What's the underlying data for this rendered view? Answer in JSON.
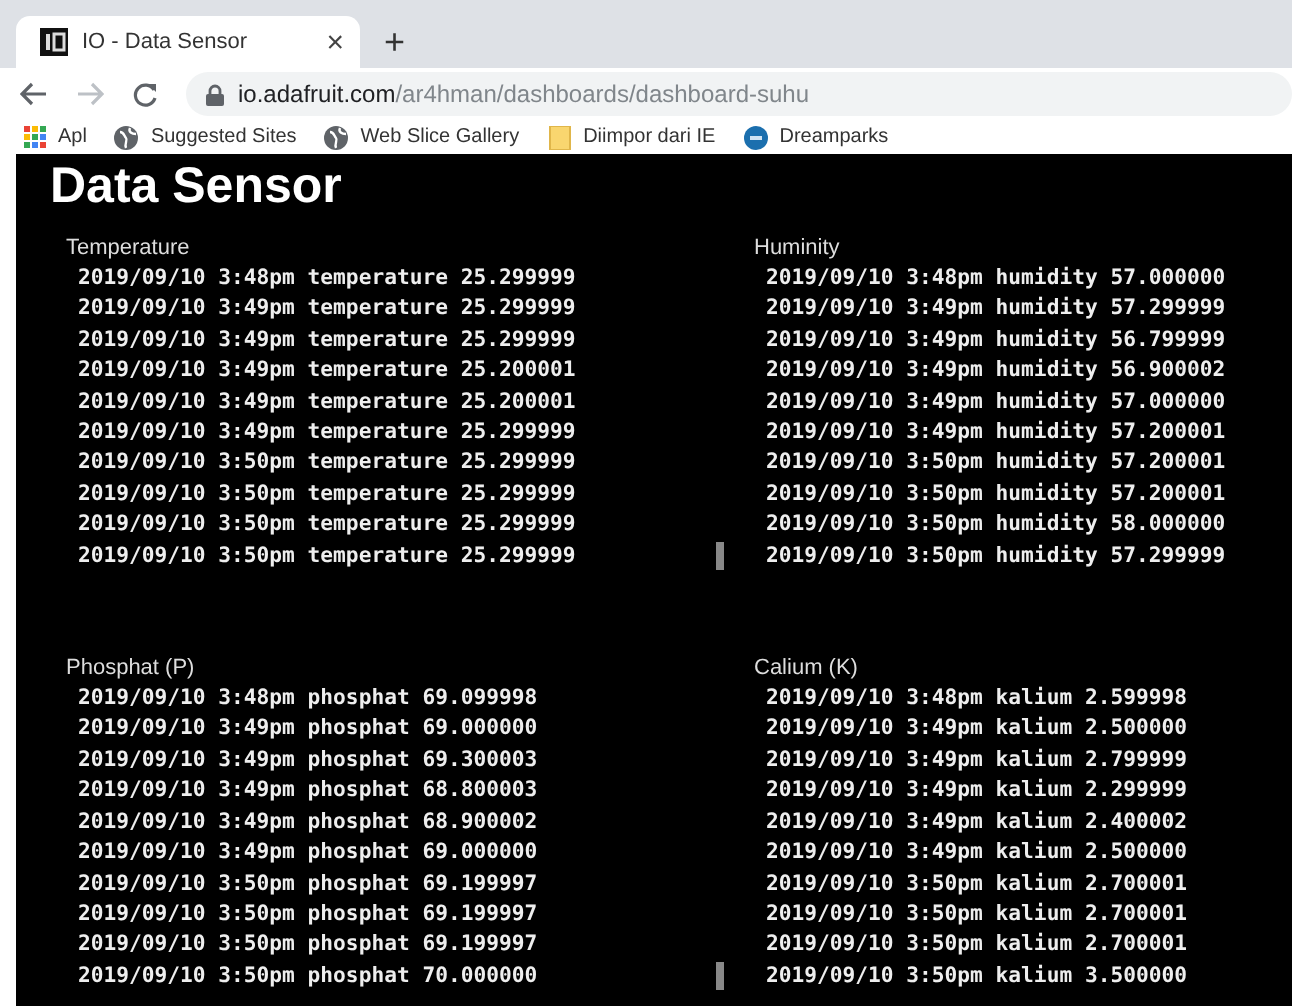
{
  "browser": {
    "tab_title": "IO - Data Sensor",
    "tab_close": "×",
    "new_tab": "+",
    "url_host": "io.adafruit.com",
    "url_path": "/ar4hman/dashboards/dashboard-suhu",
    "bookmarks": [
      {
        "kind": "apps",
        "label": "Apl"
      },
      {
        "kind": "globe",
        "label": "Suggested Sites"
      },
      {
        "kind": "globe",
        "label": "Web Slice Gallery"
      },
      {
        "kind": "folder",
        "label": "Diimpor dari IE"
      },
      {
        "kind": "circle",
        "label": "Dreamparks"
      }
    ]
  },
  "page": {
    "title": "Data Sensor"
  },
  "panels": [
    {
      "title": "Temperature",
      "lines": [
        "2019/09/10 3:48pm temperature 25.299999",
        "2019/09/10 3:49pm temperature 25.299999",
        "2019/09/10 3:49pm temperature 25.299999",
        "2019/09/10 3:49pm temperature 25.200001",
        "2019/09/10 3:49pm temperature 25.200001",
        "2019/09/10 3:49pm temperature 25.299999",
        "2019/09/10 3:50pm temperature 25.299999",
        "2019/09/10 3:50pm temperature 25.299999",
        "2019/09/10 3:50pm temperature 25.299999",
        "2019/09/10 3:50pm temperature 25.299999"
      ]
    },
    {
      "title": "Huminity",
      "lines": [
        "2019/09/10 3:48pm humidity 57.000000",
        "2019/09/10 3:49pm humidity 57.299999",
        "2019/09/10 3:49pm humidity 56.799999",
        "2019/09/10 3:49pm humidity 56.900002",
        "2019/09/10 3:49pm humidity 57.000000",
        "2019/09/10 3:49pm humidity 57.200001",
        "2019/09/10 3:50pm humidity 57.200001",
        "2019/09/10 3:50pm humidity 57.200001",
        "2019/09/10 3:50pm humidity 58.000000",
        "2019/09/10 3:50pm humidity 57.299999"
      ]
    },
    {
      "title": "Phosphat (P)",
      "lines": [
        "2019/09/10 3:48pm phosphat 69.099998",
        "2019/09/10 3:49pm phosphat 69.000000",
        "2019/09/10 3:49pm phosphat 69.300003",
        "2019/09/10 3:49pm phosphat 68.800003",
        "2019/09/10 3:49pm phosphat 68.900002",
        "2019/09/10 3:49pm phosphat 69.000000",
        "2019/09/10 3:50pm phosphat 69.199997",
        "2019/09/10 3:50pm phosphat 69.199997",
        "2019/09/10 3:50pm phosphat 69.199997",
        "2019/09/10 3:50pm phosphat 70.000000"
      ]
    },
    {
      "title": "Calium (K)",
      "lines": [
        "2019/09/10 3:48pm kalium 2.599998",
        "2019/09/10 3:49pm kalium 2.500000",
        "2019/09/10 3:49pm kalium 2.799999",
        "2019/09/10 3:49pm kalium 2.299999",
        "2019/09/10 3:49pm kalium 2.400002",
        "2019/09/10 3:49pm kalium 2.500000",
        "2019/09/10 3:50pm kalium 2.700001",
        "2019/09/10 3:50pm kalium 2.700001",
        "2019/09/10 3:50pm kalium 2.700001",
        "2019/09/10 3:50pm kalium 3.500000"
      ]
    }
  ]
}
